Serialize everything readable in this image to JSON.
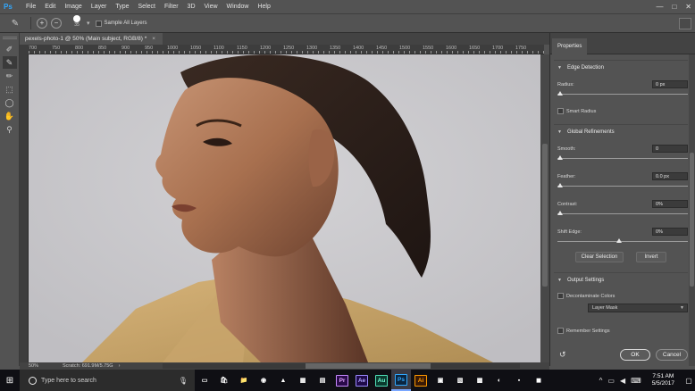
{
  "menubar": {
    "logo": "Ps",
    "items": [
      "File",
      "Edit",
      "Image",
      "Layer",
      "Type",
      "Select",
      "Filter",
      "3D",
      "View",
      "Window",
      "Help"
    ],
    "controls": [
      "—",
      "□",
      "✕"
    ]
  },
  "options": {
    "brush_size": "35",
    "sample_all_layers": "Sample All Layers"
  },
  "document": {
    "tab_title": "pexels-photo-1 @ 50% (Main subject, RGB/8) *",
    "ruler_ticks": [
      "700",
      "750",
      "800",
      "850",
      "900",
      "950",
      "1000",
      "1050",
      "1100",
      "1150",
      "1200",
      "1250",
      "1300",
      "1350",
      "1400",
      "1450",
      "1500",
      "1550",
      "1600",
      "1650",
      "1700",
      "1750"
    ],
    "zoom": "50%",
    "scratch": "Scratch: 691.9M/5.75G"
  },
  "properties": {
    "tab": "Properties",
    "edge_detection": {
      "header": "Edge Detection",
      "radius_label": "Radius:",
      "radius_value": "0 px",
      "smart_radius": "Smart Radius"
    },
    "global_refinements": {
      "header": "Global Refinements",
      "smooth_label": "Smooth:",
      "smooth_value": "0",
      "feather_label": "Feather:",
      "feather_value": "0.0 px",
      "contrast_label": "Contrast:",
      "contrast_value": "0%",
      "shift_edge_label": "Shift Edge:",
      "shift_edge_value": "0%",
      "clear_selection": "Clear Selection",
      "invert": "Invert"
    },
    "output_settings": {
      "header": "Output Settings",
      "decontaminate": "Decontaminate Colors",
      "output_to": "Layer Mask",
      "remember": "Remember Settings"
    },
    "ok": "OK",
    "cancel": "Cancel"
  },
  "taskbar": {
    "search_placeholder": "Type here to search",
    "apps": [
      "Pr",
      "Ae",
      "Au",
      "Ps",
      "Ai"
    ],
    "time": "7:51 AM",
    "date": "5/5/2017"
  },
  "colors": {
    "ps_blue": "#31a8ff",
    "pr": "#2a0a4a",
    "ae": "#1f0a4a",
    "au": "#0a3a2e",
    "ps": "#0a2540",
    "ai": "#3a1a05"
  }
}
